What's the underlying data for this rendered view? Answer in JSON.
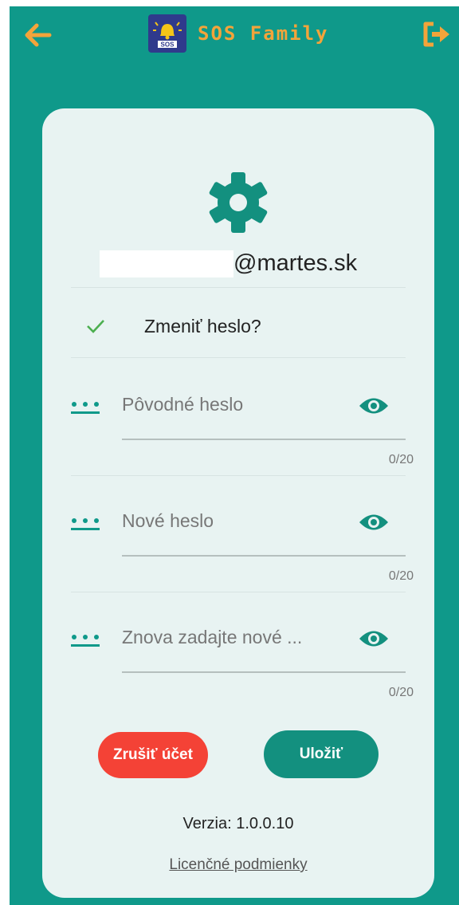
{
  "app": {
    "title": "SOS Family",
    "logo_text": "SOS"
  },
  "colors": {
    "accent": "#0f998a",
    "appbar_icons": "#f3a43a",
    "danger": "#f44236"
  },
  "header": {
    "back_icon": "arrow-left-icon",
    "logout_icon": "logout-icon"
  },
  "account": {
    "email": "@martes.sk"
  },
  "change_password": {
    "checked": true,
    "label": "Zmeniť heslo?"
  },
  "fields": [
    {
      "placeholder": "Pôvodné heslo",
      "counter": "0/20"
    },
    {
      "placeholder": "Nové heslo",
      "counter": "0/20"
    },
    {
      "placeholder": "Znova zadajte nové ...",
      "counter": "0/20"
    }
  ],
  "buttons": {
    "delete_account": "Zrušiť účet",
    "save": "Uložiť"
  },
  "footer": {
    "version": "Verzia: 1.0.0.10",
    "license": "Licenčné podmienky"
  }
}
